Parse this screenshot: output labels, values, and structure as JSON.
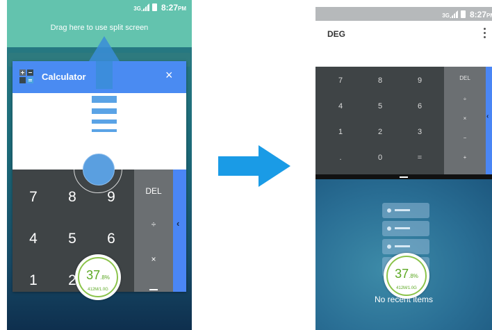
{
  "left_screen": {
    "status": {
      "network": "3G",
      "time": "8:27",
      "ampm": "PM"
    },
    "drag_hint": "Drag here to use split screen",
    "app_card": {
      "title": "Calculator",
      "close_icon": "×"
    },
    "keypad": [
      [
        "7",
        "8",
        "9"
      ],
      [
        "4",
        "5",
        "6"
      ],
      [
        "1",
        "2"
      ]
    ],
    "operators": [
      "DEL",
      "÷",
      "×"
    ],
    "side_tab_icon": "‹",
    "memory_widget": {
      "percent": "37",
      "fraction": ".8%",
      "usage": "412M/1.0G"
    }
  },
  "right_screen": {
    "status": {
      "network": "3G",
      "time": "8:27",
      "ampm": "PM"
    },
    "mode": "DEG",
    "keypad": [
      [
        "7",
        "8",
        "9"
      ],
      [
        "4",
        "5",
        "6"
      ],
      [
        "1",
        "2",
        "3"
      ],
      [
        ".",
        "0",
        "="
      ]
    ],
    "operators": [
      "DEL",
      "÷",
      "×",
      "−",
      "+"
    ],
    "side_tab_icon": "‹",
    "recents_text": "No recent items",
    "memory_widget": {
      "percent": "37",
      "fraction": ".8%",
      "usage": "412M/1.0G"
    }
  },
  "colors": {
    "teal_bar": "#63c3ae",
    "app_header": "#4a8bf2",
    "arrow": "#1a9be6",
    "memory_green": "#5ca823"
  }
}
